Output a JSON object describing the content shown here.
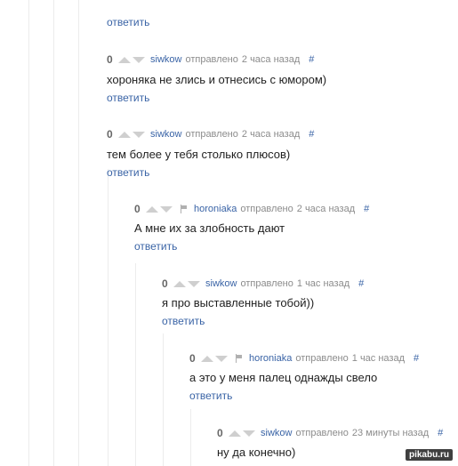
{
  "ui": {
    "reply_label": "ответить",
    "sent_label": "отправлено",
    "hash_label": "#"
  },
  "comments": [
    {
      "score": "0",
      "author": "siwkow",
      "time": "2 часа назад",
      "text": "хороняка не злись и отнесись с юмором)"
    },
    {
      "score": "0",
      "author": "siwkow",
      "time": "2 часа назад",
      "text": "тем более у тебя столько плюсов)"
    },
    {
      "score": "0",
      "author": "horoniaka",
      "time": "2 часа назад",
      "text": "А мне их за злобность дают"
    },
    {
      "score": "0",
      "author": "siwkow",
      "time": "1 час назад",
      "text": "я про выставленные тобой))"
    },
    {
      "score": "0",
      "author": "horoniaka",
      "time": "1 час назад",
      "text": "а это у меня палец однажды свело"
    },
    {
      "score": "0",
      "author": "siwkow",
      "time": "23 минуты назад",
      "text": "ну да конечно)"
    }
  ],
  "watermark": "pikabu.ru"
}
